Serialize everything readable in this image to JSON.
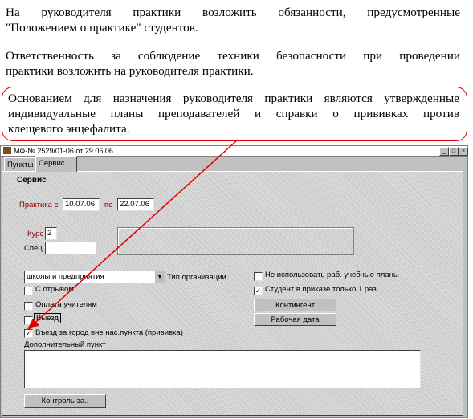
{
  "paragraph1": {
    "line1": "На руководителя практики возложить обязанности, предусмотренные",
    "line2": "\"Положением о практике\" студентов."
  },
  "paragraph2": {
    "line1": "Ответственность за соблюдение техники безопасности при проведении",
    "line2": "практики возложить на руководителя практики."
  },
  "callout": {
    "line1": "Основанием для назначения руководителя практики являются утвержденные",
    "line2": "индивидуальные планы преподавателей и справки о прививках против",
    "line3": "клещевого энцефалита."
  },
  "window": {
    "title": "МФ-№ 2529/01-06 от 29.06.06",
    "controls": {
      "minimize": "_",
      "maximize": "□",
      "close": "×"
    },
    "tabs": [
      "Пункты",
      "Сервис"
    ],
    "section_title": "Сервис",
    "practice_from_label": "Практика с",
    "practice_from_value": "10.07.06",
    "practice_to_label": "по",
    "practice_to_value": "22.07.06",
    "course_label": "Курс",
    "course_value": "2",
    "spec_label": "Спец",
    "spec_value": "",
    "org_type_value": "школы и предприятия",
    "org_type_label": "Тип организации",
    "checkboxes": {
      "with_leave": {
        "label": "С отрывом",
        "checked": false
      },
      "teacher_pay": {
        "label": "Оплата учителям",
        "checked": false
      },
      "departure": {
        "label": "Выезд",
        "checked": false
      },
      "city_entry": {
        "label": "Въезд за город вне нас.пункта (прививка)",
        "checked": true
      },
      "no_work_plans": {
        "label": "Не использовать раб. учебные планы",
        "checked": false
      },
      "student_once": {
        "label": "Студент в приказе только 1 раз",
        "checked": true
      }
    },
    "contingent_button": "Контингент",
    "work_date_button": "Рабочая дата",
    "extra_item_label": "Дополнительный пункт",
    "extra_item_value": "",
    "control_button": "Контроль за.."
  },
  "colors": {
    "callout_border": "#dd0000",
    "arrow": "#dd0000",
    "label_red": "#8b0000"
  }
}
